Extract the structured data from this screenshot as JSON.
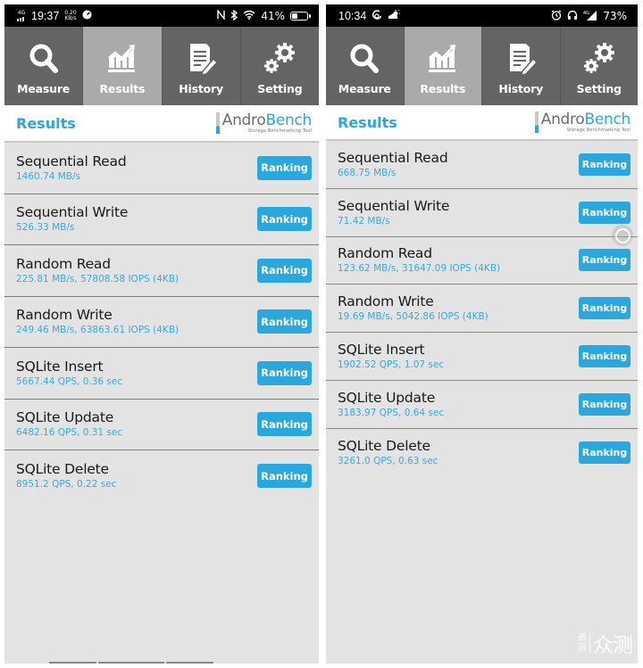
{
  "phones": {
    "left": {
      "status_bar": {
        "network": "4G",
        "time": "19:37",
        "speed_value": "0.20",
        "speed_unit": "KB/s",
        "right_icons": [
          "nfc-icon",
          "bluetooth-icon",
          "wifi-icon"
        ],
        "battery_percent_label": "41%",
        "battery_level": 0.41
      },
      "tabs": [
        {
          "label": "Measure",
          "icon": "search-icon",
          "active": false
        },
        {
          "label": "Results",
          "icon": "chart-icon",
          "active": true
        },
        {
          "label": "History",
          "icon": "document-edit-icon",
          "active": false
        },
        {
          "label": "Setting",
          "icon": "gears-icon",
          "active": false
        }
      ],
      "header": {
        "title": "Results",
        "logo_part1": "Andro",
        "logo_part2": "Bench",
        "logo_tagline": "Storage Benchmarking Tool"
      },
      "results": [
        {
          "title": "Sequential Read",
          "value": "1460.74 MB/s",
          "button": "Ranking"
        },
        {
          "title": "Sequential Write",
          "value": "526.33 MB/s",
          "button": "Ranking"
        },
        {
          "title": "Random Read",
          "value": "225.81 MB/s, 57808.58 IOPS (4KB)",
          "button": "Ranking"
        },
        {
          "title": "Random Write",
          "value": "249.46 MB/s, 63863.61 IOPS (4KB)",
          "button": "Ranking"
        },
        {
          "title": "SQLite Insert",
          "value": "5667.44 QPS, 0.36 sec",
          "button": "Ranking"
        },
        {
          "title": "SQLite Update",
          "value": "6482.16 QPS, 0.31 sec",
          "button": "Ranking"
        },
        {
          "title": "SQLite Delete",
          "value": "8951.2 QPS, 0.22 sec",
          "button": "Ranking"
        }
      ]
    },
    "right": {
      "status_bar": {
        "time": "10:34",
        "left_icons": [
          "swirl-icon",
          "weather-icon"
        ],
        "right_icons": [
          "alarm-icon",
          "headphones-icon",
          "signal-icon"
        ],
        "network": "4G",
        "battery_percent_label": "73%"
      },
      "tabs": [
        {
          "label": "Measure",
          "icon": "search-icon",
          "active": false
        },
        {
          "label": "Results",
          "icon": "chart-icon",
          "active": true
        },
        {
          "label": "History",
          "icon": "document-edit-icon",
          "active": false
        },
        {
          "label": "Setting",
          "icon": "gears-icon",
          "active": false
        }
      ],
      "header": {
        "title": "Results",
        "logo_part1": "Andro",
        "logo_part2": "Bench",
        "logo_tagline": "Storage Benchmarking Tool"
      },
      "results": [
        {
          "title": "Sequential Read",
          "value": "668.75 MB/s",
          "button": "Ranking"
        },
        {
          "title": "Sequential Write",
          "value": "71.42 MB/s",
          "button": "Ranking"
        },
        {
          "title": "Random Read",
          "value": "123.62 MB/s, 31647.09 IOPS (4KB)",
          "button": "Ranking"
        },
        {
          "title": "Random Write",
          "value": "19.69 MB/s, 5042.86 IOPS (4KB)",
          "button": "Ranking"
        },
        {
          "title": "SQLite Insert",
          "value": "1902.52 QPS, 1.07 sec",
          "button": "Ranking"
        },
        {
          "title": "SQLite Update",
          "value": "3183.97 QPS, 0.64 sec",
          "button": "Ranking"
        },
        {
          "title": "SQLite Delete",
          "value": "3261.0 QPS, 0.63 sec",
          "button": "Ranking"
        }
      ]
    }
  },
  "watermark": {
    "small_line1": "新",
    "small_line2": "浪",
    "big": "众测"
  },
  "colors": {
    "accent": "#2aa7dd",
    "tabbar": "#646464",
    "tab_active": "#aaaaaa",
    "list_bg": "#e3e3e3"
  }
}
